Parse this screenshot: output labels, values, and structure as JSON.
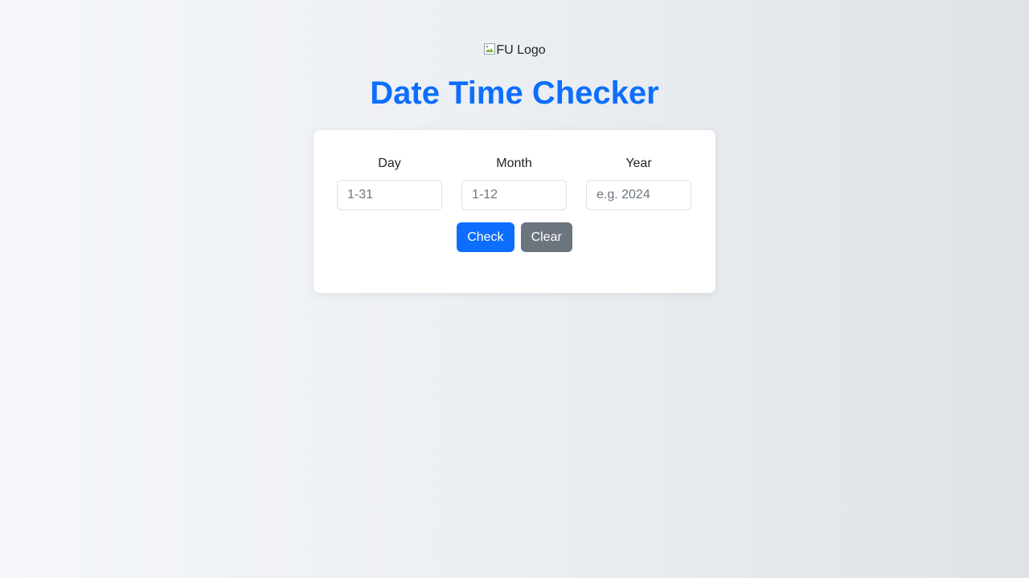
{
  "header": {
    "logo_alt": "FU Logo",
    "title": "Date Time Checker"
  },
  "form": {
    "day": {
      "label": "Day",
      "placeholder": "1-31",
      "value": ""
    },
    "month": {
      "label": "Month",
      "placeholder": "1-12",
      "value": ""
    },
    "year": {
      "label": "Year",
      "placeholder": "e.g. 2024",
      "value": ""
    }
  },
  "actions": {
    "check_label": "Check",
    "clear_label": "Clear"
  },
  "colors": {
    "accent": "#0d6efd",
    "secondary": "#6c757d"
  },
  "icons": {
    "logo": "broken-image-icon"
  }
}
